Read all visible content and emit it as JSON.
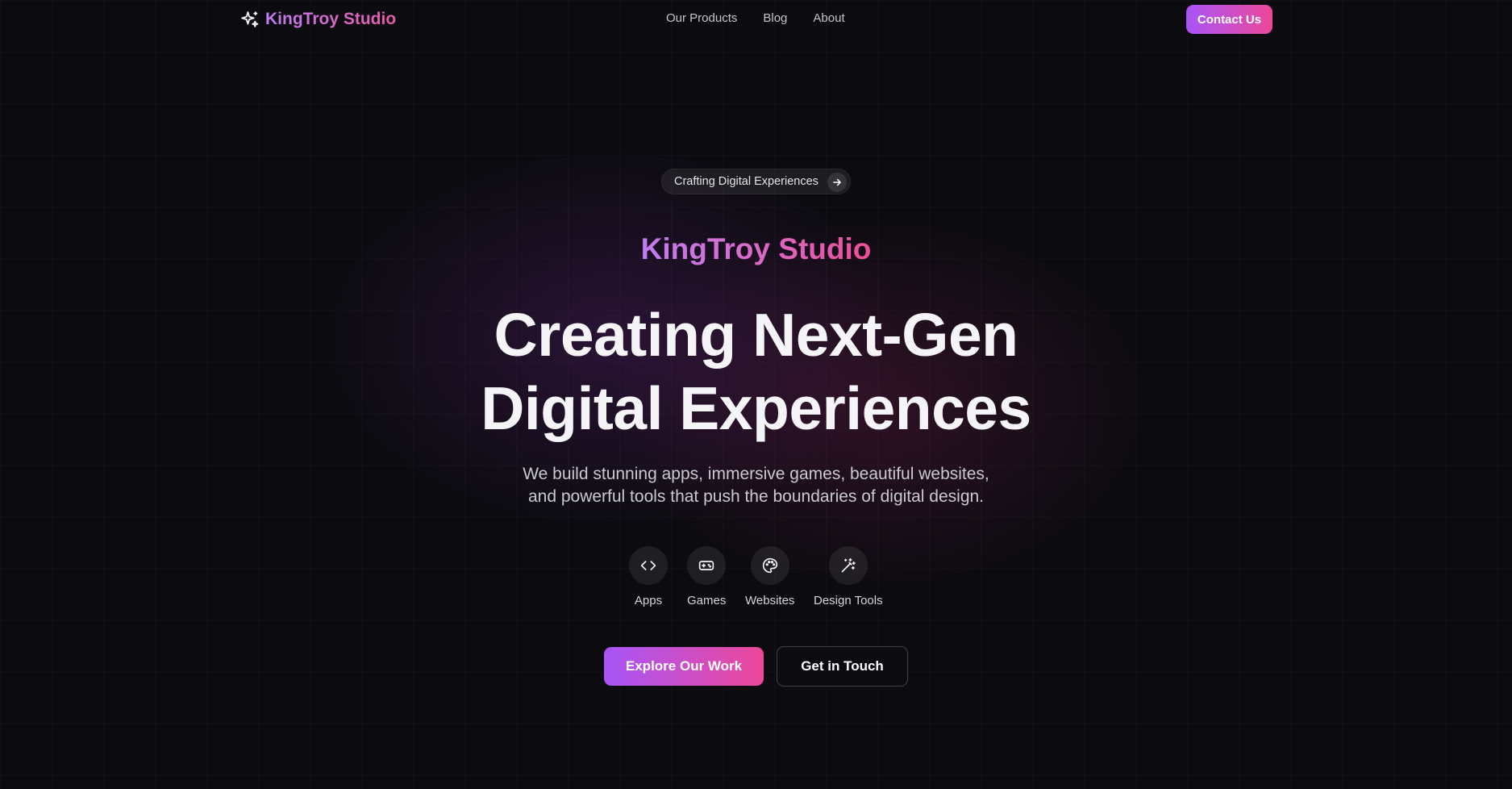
{
  "nav": {
    "brand": "KingTroy Studio",
    "brand_icon": "sparkles-icon",
    "links": [
      "Our Products",
      "Blog",
      "About"
    ],
    "contact_label": "Contact Us"
  },
  "hero": {
    "pill_text": "Crafting Digital Experiences",
    "pill_icon": "arrow-right-icon",
    "studio_name": "KingTroy Studio",
    "headline_line1": "Creating Next-Gen",
    "headline_line2": "Digital Experiences",
    "subtext_line1": "We build stunning apps, immersive games, beautiful websites,",
    "subtext_line2": "and powerful tools that push the boundaries of digital design.",
    "categories": [
      {
        "label": "Apps",
        "icon": "code-icon"
      },
      {
        "label": "Games",
        "icon": "gamepad-icon"
      },
      {
        "label": "Websites",
        "icon": "palette-icon"
      },
      {
        "label": "Design Tools",
        "icon": "magic-wand-icon"
      }
    ],
    "primary_cta": "Explore Our Work",
    "secondary_cta": "Get in Touch"
  },
  "colors": {
    "background": "#0c0b10",
    "gradient_start": "#a855f7",
    "gradient_end": "#ec4899",
    "text_primary": "#f5f5f7",
    "text_muted": "#c9c9d0"
  }
}
